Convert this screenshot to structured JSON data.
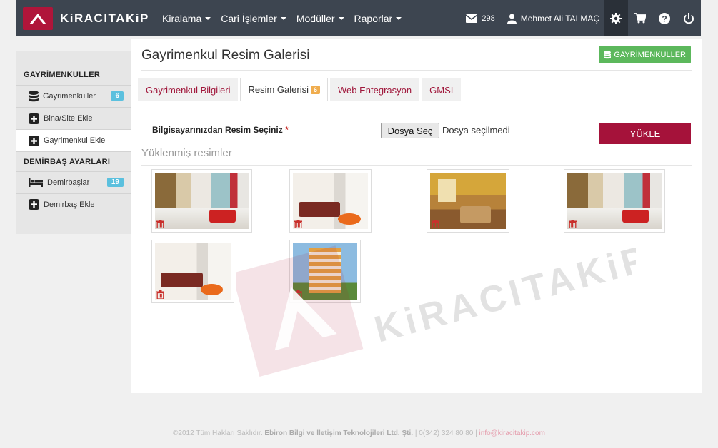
{
  "brand": {
    "name": "KiRACITAKiP"
  },
  "menu": [
    {
      "label": "Kiralama"
    },
    {
      "label": "Cari İşlemler"
    },
    {
      "label": "Modüller"
    },
    {
      "label": "Raporlar"
    }
  ],
  "nav": {
    "messages_count": "298",
    "user_name": "Mehmet Ali TALMAÇ"
  },
  "sidebar": {
    "section1": "GAYRİMENKULLER",
    "items1": [
      {
        "label": "Gayrimenkuller",
        "badge": "6"
      },
      {
        "label": "Bina/Site Ekle"
      },
      {
        "label": "Gayrimenkul Ekle"
      }
    ],
    "section2": "DEMİRBAŞ AYARLARI",
    "items2": [
      {
        "label": "Demirbaşlar",
        "badge": "19"
      },
      {
        "label": "Demirbaş Ekle"
      }
    ]
  },
  "page": {
    "title": "Gayrimenkul Resim Galerisi",
    "top_button": "GAYRİMENKULLER",
    "tabs": [
      {
        "label": "Gayrimenkul Bilgileri"
      },
      {
        "label": "Resim Galerisi",
        "badge": "6"
      },
      {
        "label": "Web Entegrasyon"
      },
      {
        "label": "GMSI"
      }
    ],
    "upload_label": "Bilgisayarınızdan Resim Seçiniz",
    "required_mark": "*",
    "file_button": "Dosya Seç",
    "file_status": "Dosya seçilmedi",
    "upload_button": "YÜKLE",
    "gallery_title": "Yüklenmiş resimler"
  },
  "footer": {
    "copyright": "©2012 Tüm Hakları Saklıdır.",
    "company": "Ebiron Bilgi ve İletişim Teknolojileri Ltd. Şti.",
    "phone": "| 0(342) 324 80 80 |",
    "email": "info@kiracitakip.com"
  },
  "colors": {
    "navbar": "#3d4550",
    "brand": "#a5123a",
    "green": "#5cb85c",
    "badge_blue": "#5bc0de",
    "badge_orange": "#f0ad4e"
  }
}
